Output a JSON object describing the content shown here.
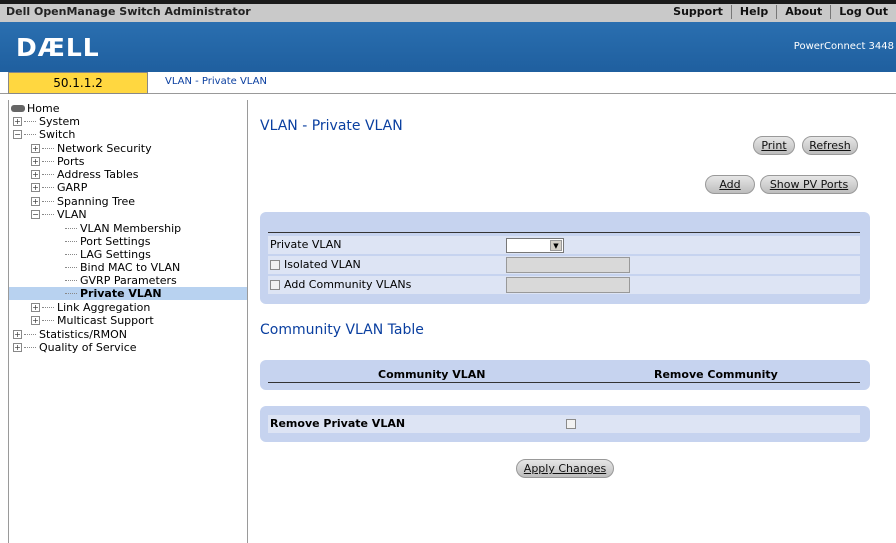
{
  "app": {
    "title": "Dell OpenManage Switch Administrator",
    "nav": [
      "Support",
      "Help",
      "About",
      "Log Out"
    ],
    "logo": "DÆLL",
    "model": "PowerConnect 3448"
  },
  "address": {
    "ip": "50.1.1.2",
    "breadcrumb": "VLAN - Private VLAN"
  },
  "tree": {
    "home": "Home",
    "system": "System",
    "switch": "Switch",
    "network_security": "Network Security",
    "ports": "Ports",
    "address_tables": "Address Tables",
    "garp": "GARP",
    "spanning_tree": "Spanning Tree",
    "vlan": "VLAN",
    "vlan_membership": "VLAN Membership",
    "port_settings": "Port Settings",
    "lag_settings": "LAG Settings",
    "bind_mac": "Bind MAC to VLAN",
    "gvrp": "GVRP Parameters",
    "private_vlan": "Private VLAN",
    "link_aggregation": "Link Aggregation",
    "multicast": "Multicast Support",
    "statistics": "Statistics/RMON",
    "qos": "Quality of Service"
  },
  "page": {
    "title": "VLAN - Private VLAN",
    "print": "Print",
    "refresh": "Refresh",
    "add": "Add",
    "show_pv_ports": "Show PV Ports",
    "private_vlan_label": "Private VLAN",
    "private_vlan_value": "",
    "isolated_vlan_label": "Isolated VLAN",
    "add_community_label": "Add Community VLANs",
    "community_table_title": "Community VLAN Table",
    "col_community_vlan": "Community VLAN",
    "col_remove_community": "Remove Community",
    "remove_private_vlan_label": "Remove Private VLAN",
    "apply_changes": "Apply Changes"
  }
}
